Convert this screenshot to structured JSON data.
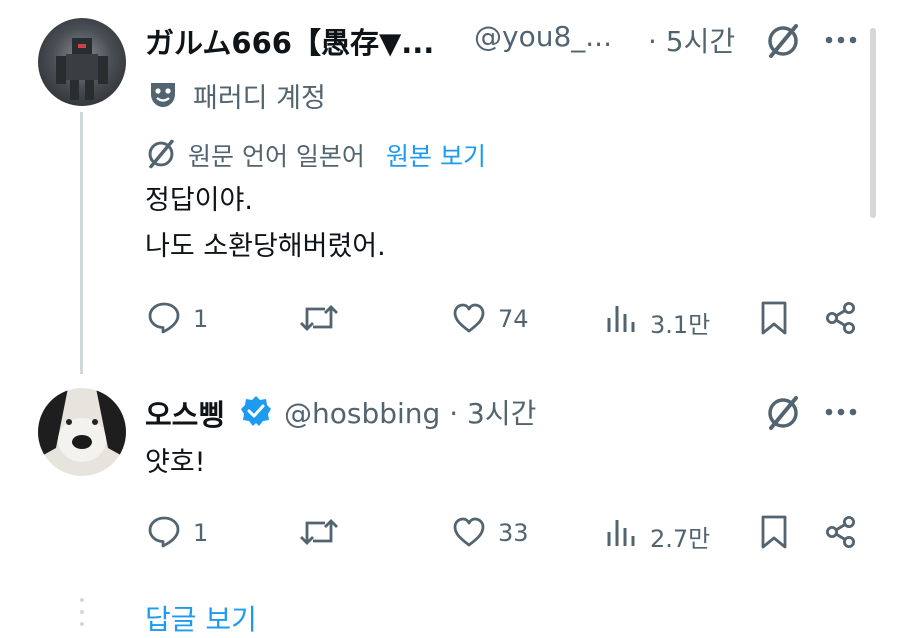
{
  "tweet1": {
    "display_name": "ガルム666【愚存▼...",
    "handle": "@you8_...",
    "time": "· 5시간",
    "parody_label": "패러디 계정",
    "translate_note": "원문 언어 일본어",
    "show_original": "원본 보기",
    "text_lines": [
      "정답이야.",
      "나도 소환당해버렸어."
    ],
    "stats": {
      "replies": "1",
      "likes": "74",
      "views": "3.1만"
    }
  },
  "tweet2": {
    "display_name": "오스삥",
    "handle": "@hosbbing · 3시간",
    "text": "얏호!",
    "stats": {
      "replies": "1",
      "likes": "33",
      "views": "2.7만"
    }
  },
  "show_replies": "답글 보기",
  "colors": {
    "text": "#0f1419",
    "muted": "#536471",
    "accent": "#1d9bf0",
    "verified": "#1d9bf0",
    "line": "#cfd9de"
  },
  "icons": [
    "grok-icon",
    "more-icon",
    "mask-icon",
    "reply-icon",
    "retweet-icon",
    "like-icon",
    "views-icon",
    "bookmark-icon",
    "share-icon",
    "verified-badge-icon"
  ]
}
